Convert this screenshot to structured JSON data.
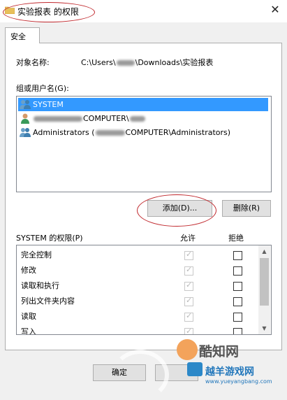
{
  "window": {
    "title": "实验报表 的权限",
    "close_glyph": "✕"
  },
  "tabs": [
    "安全"
  ],
  "object": {
    "label": "对象名称:",
    "path_prefix": "C:\\Users\\",
    "path_suffix": "\\Downloads\\实验报表"
  },
  "groups": {
    "label": "组或用户名(G):",
    "users": [
      {
        "text_before": "",
        "text_after": "SYSTEM",
        "icon": "group-users-icon",
        "selected": true
      },
      {
        "text_before": "",
        "text_middle": "COMPUTER\\",
        "text_after": "",
        "icon": "user-icon",
        "selected": false
      },
      {
        "text_before": "Administrators (",
        "text_middle": "COMPUTER\\Administrators)",
        "text_after": "",
        "icon": "group-users-icon",
        "selected": false
      }
    ]
  },
  "buttons": {
    "add": "添加(D)...",
    "remove": "删除(R)"
  },
  "permissions": {
    "label": "SYSTEM 的权限(P)",
    "allow_header": "允许",
    "deny_header": "拒绝",
    "rows": [
      {
        "name": "完全控制",
        "allow": true,
        "allow_disabled": true,
        "deny": false
      },
      {
        "name": "修改",
        "allow": true,
        "allow_disabled": true,
        "deny": false
      },
      {
        "name": "读取和执行",
        "allow": true,
        "allow_disabled": true,
        "deny": false
      },
      {
        "name": "列出文件夹内容",
        "allow": true,
        "allow_disabled": true,
        "deny": false
      },
      {
        "name": "读取",
        "allow": true,
        "allow_disabled": true,
        "deny": false
      },
      {
        "name": "写入",
        "allow": true,
        "allow_disabled": true,
        "deny": false
      }
    ]
  },
  "bottom_buttons": [
    "确定"
  ],
  "watermark": {
    "brand1": "酷知网",
    "brand2": "越羊游戏网",
    "url": "www.yueyangbang.com"
  },
  "colors": {
    "selection": "#3399ff",
    "annotation_red": "#c0282d"
  }
}
